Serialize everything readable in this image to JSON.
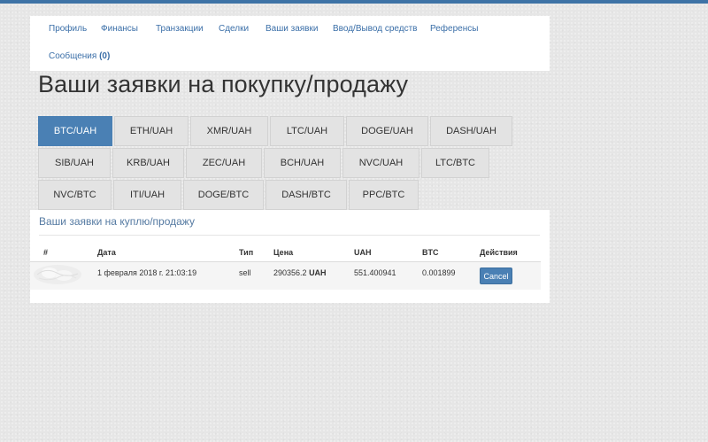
{
  "colors": {
    "accent": "#4a80b4",
    "link": "#3b6fa8",
    "top_strip": "#3e73a6",
    "page_bg": "#e6e6e6"
  },
  "nav": {
    "items": [
      {
        "label": "Профиль"
      },
      {
        "label": "Финансы"
      },
      {
        "label": "Транзакции"
      },
      {
        "label": "Сделки"
      },
      {
        "label": "Ваши заявки"
      },
      {
        "label": "Ввод/Вывод средств"
      },
      {
        "label": "Референсы"
      }
    ],
    "messages": {
      "label": "Сообщения",
      "count": "(0)"
    }
  },
  "page": {
    "title": "Ваши заявки на покупку/продажу"
  },
  "pair_tabs": [
    {
      "label": "BTC/UAH",
      "active": true
    },
    {
      "label": "ETH/UAH"
    },
    {
      "label": "XMR/UAH"
    },
    {
      "label": "LTC/UAH"
    },
    {
      "label": "DOGE/UAH"
    },
    {
      "label": "DASH/UAH"
    },
    {
      "label": "SIB/UAH"
    },
    {
      "label": "KRB/UAH"
    },
    {
      "label": "ZEC/UAH"
    },
    {
      "label": "BCH/UAH"
    },
    {
      "label": "NVC/UAH"
    },
    {
      "label": "LTC/BTC"
    },
    {
      "label": "NVC/BTC"
    },
    {
      "label": "ITI/UAH"
    },
    {
      "label": "DOGE/BTC"
    },
    {
      "label": "DASH/BTC"
    },
    {
      "label": "PPC/BTC"
    }
  ],
  "orders": {
    "title": "Ваши заявки на куплю/продажу",
    "columns": {
      "num": "#",
      "date": "Дата",
      "type": "Тип",
      "price": "Цена",
      "uah": "UAH",
      "btc": "BTC",
      "actions": "Действия"
    },
    "rows": [
      {
        "date": "1 февраля 2018 г. 21:03:19",
        "type": "sell",
        "price": "290356.2",
        "price_unit": "UAH",
        "uah": "551.400941",
        "btc": "0.001899",
        "action": "Cancel"
      }
    ]
  }
}
